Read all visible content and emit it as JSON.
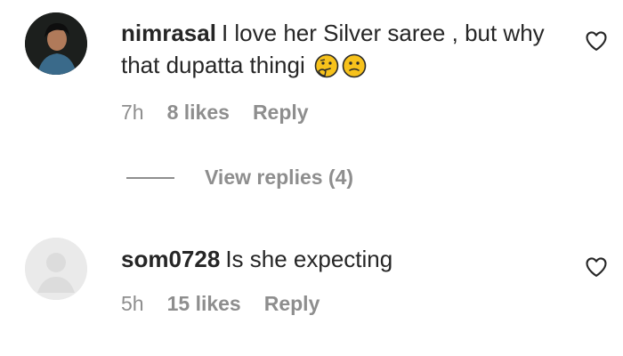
{
  "comments": [
    {
      "username": "nimrasal",
      "text": "I love her Silver saree , but why that dupatta thingi",
      "emojis": [
        "thinking-face-emoji",
        "confused-face-emoji"
      ],
      "time": "7h",
      "likes": "8 likes",
      "reply": "Reply"
    },
    {
      "username": "som0728",
      "text": "Is she expecting",
      "time": "5h",
      "likes": "15 likes",
      "reply": "Reply"
    }
  ],
  "view_replies": "View replies (4)",
  "icons": {
    "like": "heart-outline-icon"
  }
}
